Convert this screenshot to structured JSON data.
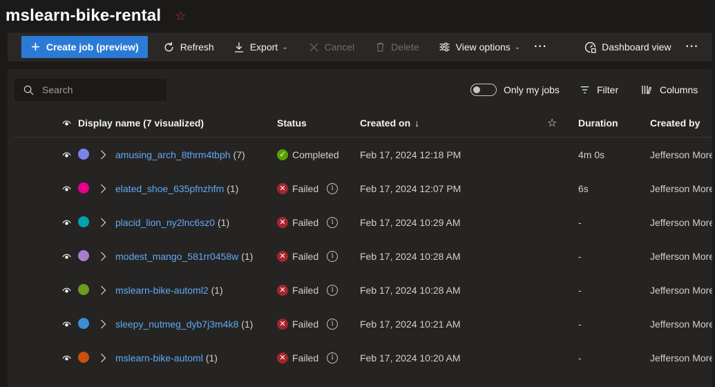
{
  "page": {
    "title": "mslearn-bike-rental"
  },
  "toolbar": {
    "create_label": "Create job (preview)",
    "refresh_label": "Refresh",
    "export_label": "Export",
    "cancel_label": "Cancel",
    "delete_label": "Delete",
    "view_options_label": "View options",
    "more_label": "···",
    "dashboard_label": "Dashboard view",
    "more2_label": "···"
  },
  "filters": {
    "search_placeholder": "Search",
    "only_my_jobs_label": "Only my jobs",
    "only_my_jobs_on": false,
    "filter_label": "Filter",
    "columns_label": "Columns"
  },
  "table": {
    "headers": {
      "display_name": "Display name (7 visualized)",
      "status": "Status",
      "created_on": "Created on",
      "sort_indicator": "↓",
      "duration": "Duration",
      "created_by": "Created by"
    },
    "rows": [
      {
        "name": "amusing_arch_8thrm4tbph",
        "count": "(7)",
        "color": "#7b83eb",
        "status": "Completed",
        "status_type": "ok",
        "created": "Feb 17, 2024 12:18 PM",
        "duration": "4m 0s",
        "created_by": "Jefferson More"
      },
      {
        "name": "elated_shoe_635pfnzhfm",
        "count": "(1)",
        "color": "#e3008c",
        "status": "Failed",
        "status_type": "fail",
        "created": "Feb 17, 2024 12:07 PM",
        "duration": "6s",
        "created_by": "Jefferson More"
      },
      {
        "name": "placid_lion_ny2lnc6sz0",
        "count": "(1)",
        "color": "#00a2ad",
        "status": "Failed",
        "status_type": "fail",
        "created": "Feb 17, 2024 10:29 AM",
        "duration": "-",
        "created_by": "Jefferson More"
      },
      {
        "name": "modest_mango_581rr0458w",
        "count": "(1)",
        "color": "#a67fcc",
        "status": "Failed",
        "status_type": "fail",
        "created": "Feb 17, 2024 10:28 AM",
        "duration": "-",
        "created_by": "Jefferson More"
      },
      {
        "name": "mslearn-bike-automl2",
        "count": "(1)",
        "color": "#6b9e1f",
        "status": "Failed",
        "status_type": "fail",
        "created": "Feb 17, 2024 10:28 AM",
        "duration": "-",
        "created_by": "Jefferson More"
      },
      {
        "name": "sleepy_nutmeg_dyb7j3m4k8",
        "count": "(1)",
        "color": "#3a8fd6",
        "status": "Failed",
        "status_type": "fail",
        "created": "Feb 17, 2024 10:21 AM",
        "duration": "-",
        "created_by": "Jefferson More"
      },
      {
        "name": "mslearn-bike-automl",
        "count": "(1)",
        "color": "#ca5010",
        "status": "Failed",
        "status_type": "fail",
        "created": "Feb 17, 2024 10:20 AM",
        "duration": "-",
        "created_by": "Jefferson More"
      }
    ]
  },
  "colors": {
    "accent": "#2b7bd6",
    "link": "#62a8f5",
    "success": "#57a300",
    "failure": "#a4262c",
    "favorite": "#d13438"
  }
}
